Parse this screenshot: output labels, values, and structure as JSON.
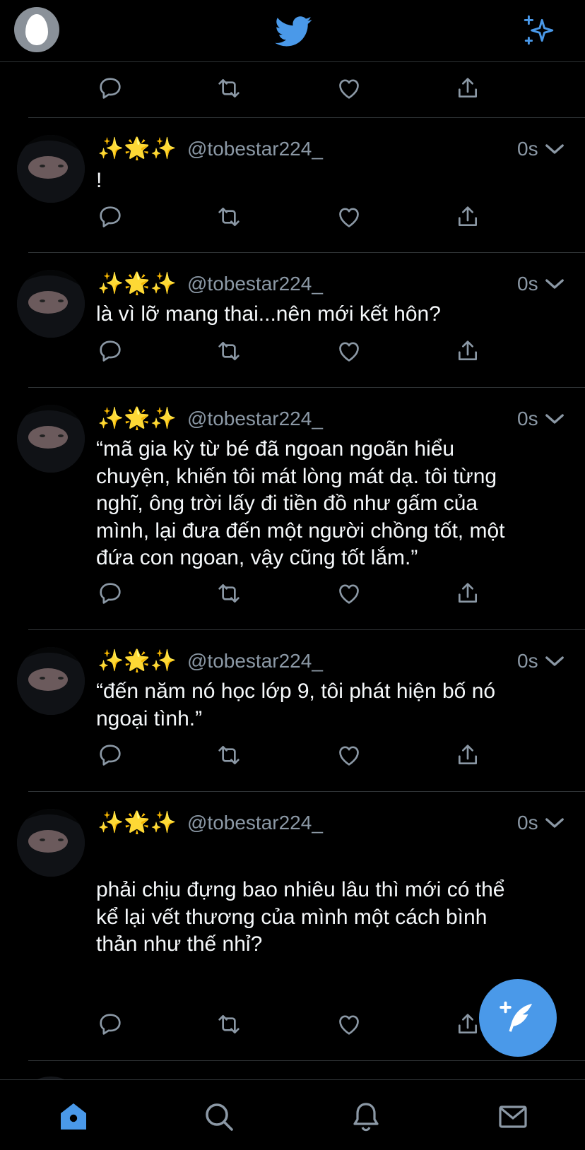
{
  "header": {
    "avatar_icon": "default-egg-avatar",
    "logo_icon": "twitter-bird-icon",
    "top_tweets_icon": "sparkle-icon"
  },
  "colors": {
    "accent": "#4a99e9",
    "background": "#000000",
    "muted": "#8b98a5",
    "divider": "#2f3336"
  },
  "tweets": [
    {
      "name": "✨🌟✨",
      "handle": "@tobestar224_",
      "time": "0s",
      "lines": [
        "!"
      ]
    },
    {
      "name": "✨🌟✨",
      "handle": "@tobestar224_",
      "time": "0s",
      "lines": [
        "là vì lỡ mang thai...nên mới kết hôn?"
      ]
    },
    {
      "name": "✨🌟✨",
      "handle": "@tobestar224_",
      "time": "0s",
      "lines": [
        "“mã gia kỳ từ bé đã ngoan ngoãn hiểu",
        "chuyện, khiến tôi mát lòng mát dạ. tôi từng",
        "nghĩ, ông trời lấy đi tiền đồ như gấm của",
        "mình, lại đưa đến một người chồng tốt, một",
        "đứa con ngoan, vậy cũng tốt lắm.”"
      ]
    },
    {
      "name": "✨🌟✨",
      "handle": "@tobestar224_",
      "time": "0s",
      "lines": [
        "“đến năm nó học lớp 9, tôi phát hiện bố nó",
        "ngoại tình.”"
      ]
    },
    {
      "name": "✨🌟✨",
      "handle": "@tobestar224_",
      "time": "0s",
      "lines": [
        "phải chịu đựng bao nhiêu lâu thì mới có thể",
        "kể lại vết thương của mình một cách bình",
        "thản như thế nhỉ?"
      ]
    }
  ],
  "tabbar": [
    "home-icon",
    "search-icon",
    "notifications-icon",
    "messages-icon"
  ]
}
